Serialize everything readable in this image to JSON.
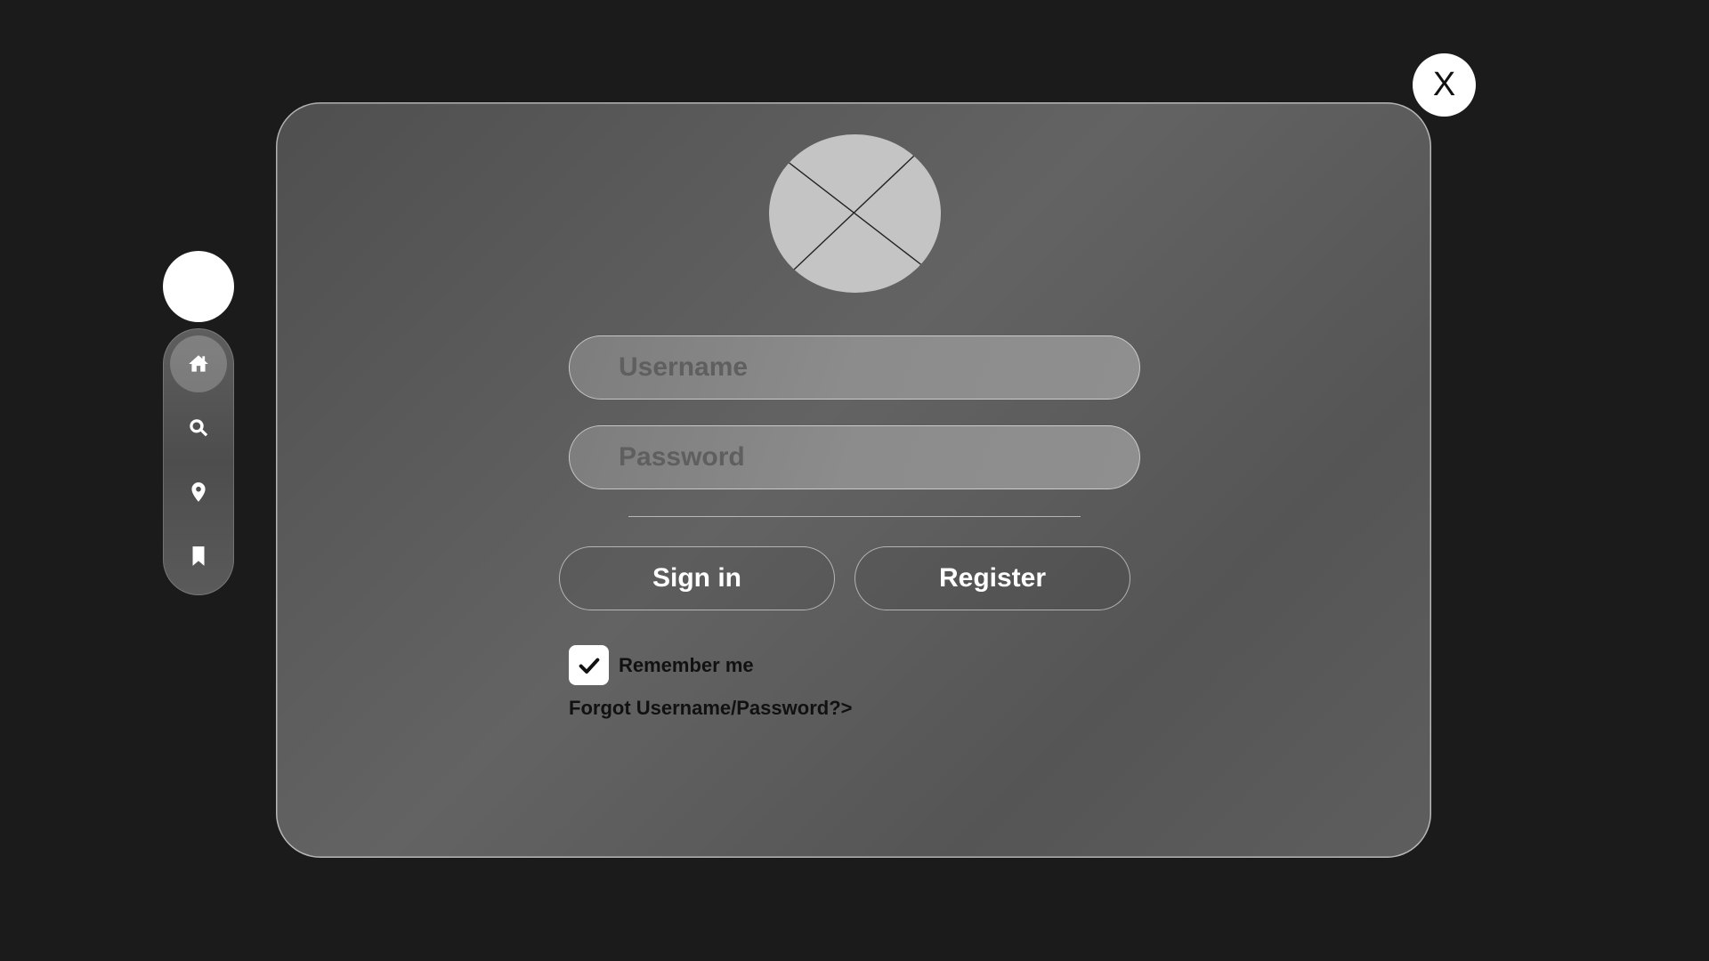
{
  "close": {
    "label": "X"
  },
  "nav": {
    "items": [
      {
        "name": "home",
        "icon": "home-icon",
        "active": true
      },
      {
        "name": "search",
        "icon": "search-icon",
        "active": false
      },
      {
        "name": "location",
        "icon": "location-pin-icon",
        "active": false
      },
      {
        "name": "bookmark",
        "icon": "bookmark-icon",
        "active": false
      }
    ]
  },
  "login": {
    "username_placeholder": "Username",
    "password_placeholder": "Password",
    "sign_in_label": "Sign in",
    "register_label": "Register",
    "remember_label": "Remember me",
    "remember_checked": true,
    "forgot_label": "Forgot Username/Password?>"
  },
  "colors": {
    "background": "#1b1b1b",
    "panel": "#5a5a5a",
    "field": "#8a8a8a",
    "avatar_placeholder": "#c4c4c4"
  }
}
